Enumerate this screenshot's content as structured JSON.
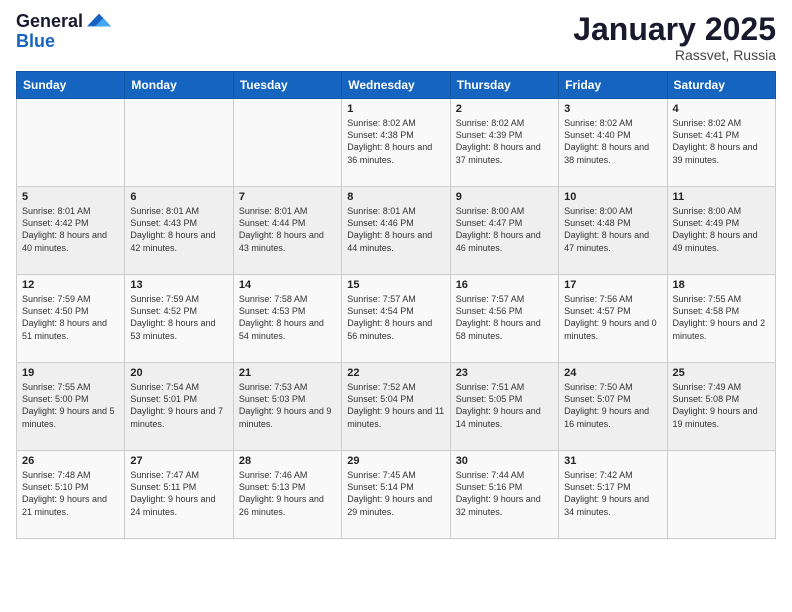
{
  "header": {
    "logo_general": "General",
    "logo_blue": "Blue",
    "month_title": "January 2025",
    "location": "Rassvet, Russia"
  },
  "days_of_week": [
    "Sunday",
    "Monday",
    "Tuesday",
    "Wednesday",
    "Thursday",
    "Friday",
    "Saturday"
  ],
  "weeks": [
    [
      {
        "day": "",
        "info": ""
      },
      {
        "day": "",
        "info": ""
      },
      {
        "day": "",
        "info": ""
      },
      {
        "day": "1",
        "info": "Sunrise: 8:02 AM\nSunset: 4:38 PM\nDaylight: 8 hours and 36 minutes."
      },
      {
        "day": "2",
        "info": "Sunrise: 8:02 AM\nSunset: 4:39 PM\nDaylight: 8 hours and 37 minutes."
      },
      {
        "day": "3",
        "info": "Sunrise: 8:02 AM\nSunset: 4:40 PM\nDaylight: 8 hours and 38 minutes."
      },
      {
        "day": "4",
        "info": "Sunrise: 8:02 AM\nSunset: 4:41 PM\nDaylight: 8 hours and 39 minutes."
      }
    ],
    [
      {
        "day": "5",
        "info": "Sunrise: 8:01 AM\nSunset: 4:42 PM\nDaylight: 8 hours and 40 minutes."
      },
      {
        "day": "6",
        "info": "Sunrise: 8:01 AM\nSunset: 4:43 PM\nDaylight: 8 hours and 42 minutes."
      },
      {
        "day": "7",
        "info": "Sunrise: 8:01 AM\nSunset: 4:44 PM\nDaylight: 8 hours and 43 minutes."
      },
      {
        "day": "8",
        "info": "Sunrise: 8:01 AM\nSunset: 4:46 PM\nDaylight: 8 hours and 44 minutes."
      },
      {
        "day": "9",
        "info": "Sunrise: 8:00 AM\nSunset: 4:47 PM\nDaylight: 8 hours and 46 minutes."
      },
      {
        "day": "10",
        "info": "Sunrise: 8:00 AM\nSunset: 4:48 PM\nDaylight: 8 hours and 47 minutes."
      },
      {
        "day": "11",
        "info": "Sunrise: 8:00 AM\nSunset: 4:49 PM\nDaylight: 8 hours and 49 minutes."
      }
    ],
    [
      {
        "day": "12",
        "info": "Sunrise: 7:59 AM\nSunset: 4:50 PM\nDaylight: 8 hours and 51 minutes."
      },
      {
        "day": "13",
        "info": "Sunrise: 7:59 AM\nSunset: 4:52 PM\nDaylight: 8 hours and 53 minutes."
      },
      {
        "day": "14",
        "info": "Sunrise: 7:58 AM\nSunset: 4:53 PM\nDaylight: 8 hours and 54 minutes."
      },
      {
        "day": "15",
        "info": "Sunrise: 7:57 AM\nSunset: 4:54 PM\nDaylight: 8 hours and 56 minutes."
      },
      {
        "day": "16",
        "info": "Sunrise: 7:57 AM\nSunset: 4:56 PM\nDaylight: 8 hours and 58 minutes."
      },
      {
        "day": "17",
        "info": "Sunrise: 7:56 AM\nSunset: 4:57 PM\nDaylight: 9 hours and 0 minutes."
      },
      {
        "day": "18",
        "info": "Sunrise: 7:55 AM\nSunset: 4:58 PM\nDaylight: 9 hours and 2 minutes."
      }
    ],
    [
      {
        "day": "19",
        "info": "Sunrise: 7:55 AM\nSunset: 5:00 PM\nDaylight: 9 hours and 5 minutes."
      },
      {
        "day": "20",
        "info": "Sunrise: 7:54 AM\nSunset: 5:01 PM\nDaylight: 9 hours and 7 minutes."
      },
      {
        "day": "21",
        "info": "Sunrise: 7:53 AM\nSunset: 5:03 PM\nDaylight: 9 hours and 9 minutes."
      },
      {
        "day": "22",
        "info": "Sunrise: 7:52 AM\nSunset: 5:04 PM\nDaylight: 9 hours and 11 minutes."
      },
      {
        "day": "23",
        "info": "Sunrise: 7:51 AM\nSunset: 5:05 PM\nDaylight: 9 hours and 14 minutes."
      },
      {
        "day": "24",
        "info": "Sunrise: 7:50 AM\nSunset: 5:07 PM\nDaylight: 9 hours and 16 minutes."
      },
      {
        "day": "25",
        "info": "Sunrise: 7:49 AM\nSunset: 5:08 PM\nDaylight: 9 hours and 19 minutes."
      }
    ],
    [
      {
        "day": "26",
        "info": "Sunrise: 7:48 AM\nSunset: 5:10 PM\nDaylight: 9 hours and 21 minutes."
      },
      {
        "day": "27",
        "info": "Sunrise: 7:47 AM\nSunset: 5:11 PM\nDaylight: 9 hours and 24 minutes."
      },
      {
        "day": "28",
        "info": "Sunrise: 7:46 AM\nSunset: 5:13 PM\nDaylight: 9 hours and 26 minutes."
      },
      {
        "day": "29",
        "info": "Sunrise: 7:45 AM\nSunset: 5:14 PM\nDaylight: 9 hours and 29 minutes."
      },
      {
        "day": "30",
        "info": "Sunrise: 7:44 AM\nSunset: 5:16 PM\nDaylight: 9 hours and 32 minutes."
      },
      {
        "day": "31",
        "info": "Sunrise: 7:42 AM\nSunset: 5:17 PM\nDaylight: 9 hours and 34 minutes."
      },
      {
        "day": "",
        "info": ""
      }
    ]
  ]
}
